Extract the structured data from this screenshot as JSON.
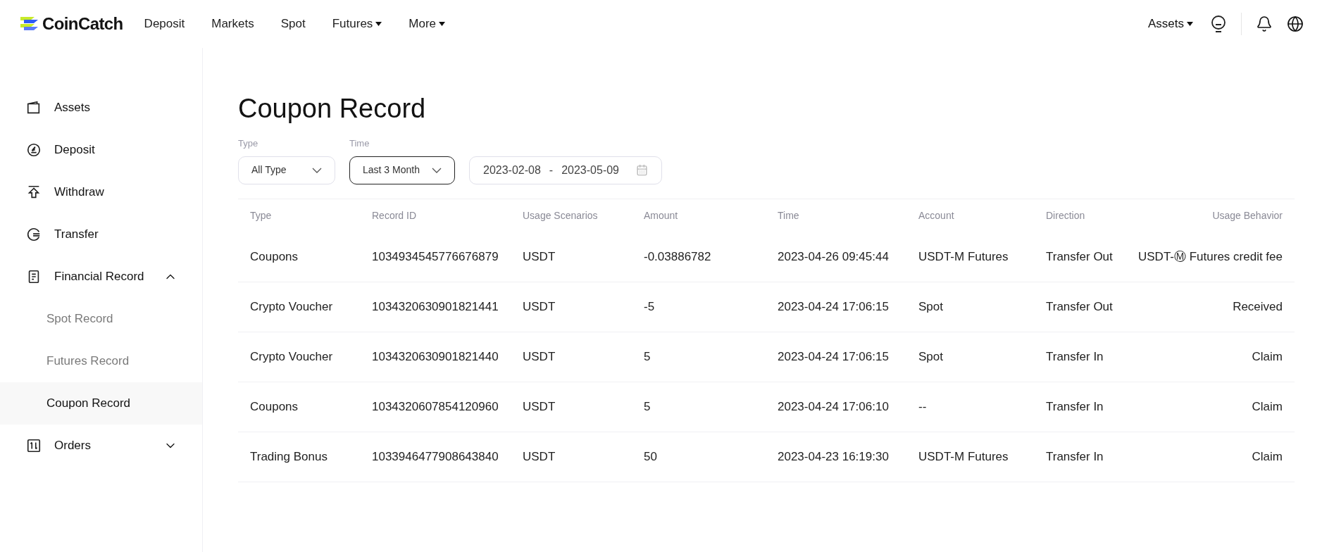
{
  "header": {
    "brand": "CoinCatch",
    "nav": [
      {
        "label": "Deposit",
        "has_menu": false
      },
      {
        "label": "Markets",
        "has_menu": false
      },
      {
        "label": "Spot",
        "has_menu": false
      },
      {
        "label": "Futures",
        "has_menu": true
      },
      {
        "label": "More",
        "has_menu": true
      }
    ],
    "assets_menu": "Assets"
  },
  "sidebar": {
    "items": [
      {
        "label": "Assets",
        "kind": "wallet"
      },
      {
        "label": "Deposit",
        "kind": "deposit"
      },
      {
        "label": "Withdraw",
        "kind": "withdraw"
      },
      {
        "label": "Transfer",
        "kind": "transfer"
      },
      {
        "label": "Financial Record",
        "kind": "record",
        "expanded": true,
        "children": [
          {
            "label": "Spot Record",
            "selected": false
          },
          {
            "label": "Futures Record",
            "selected": false
          },
          {
            "label": "Coupon Record",
            "selected": true
          }
        ]
      },
      {
        "label": "Orders",
        "kind": "orders",
        "expanded": false
      }
    ]
  },
  "page_title": "Coupon Record",
  "filters": {
    "type": {
      "label": "Type",
      "value": "All Type"
    },
    "time": {
      "label": "Time",
      "value": "Last 3 Month"
    },
    "date_range": {
      "start": "2023-02-08",
      "separator": "-",
      "end": "2023-05-09"
    }
  },
  "table": {
    "columns": [
      "Type",
      "Record ID",
      "Usage Scenarios",
      "Amount",
      "Time",
      "Account",
      "Direction",
      "Usage Behavior"
    ],
    "rows": [
      [
        "Coupons",
        "1034934545776676879",
        "USDT",
        "-0.03886782",
        "2023-04-26 09:45:44",
        "USDT-M Futures",
        "Transfer Out",
        "USDT-Ⓜ Futures credit fee"
      ],
      [
        "Crypto Voucher",
        "1034320630901821441",
        "USDT",
        "-5",
        "2023-04-24 17:06:15",
        "Spot",
        "Transfer Out",
        "Received"
      ],
      [
        "Crypto Voucher",
        "1034320630901821440",
        "USDT",
        "5",
        "2023-04-24 17:06:15",
        "Spot",
        "Transfer In",
        "Claim"
      ],
      [
        "Coupons",
        "1034320607854120960",
        "USDT",
        "5",
        "2023-04-24 17:06:10",
        "--",
        "Transfer In",
        "Claim"
      ],
      [
        "Trading Bonus",
        "1033946477908643840",
        "USDT",
        "50",
        "2023-04-23 16:19:30",
        "USDT-M Futures",
        "Transfer In",
        "Claim"
      ]
    ]
  }
}
